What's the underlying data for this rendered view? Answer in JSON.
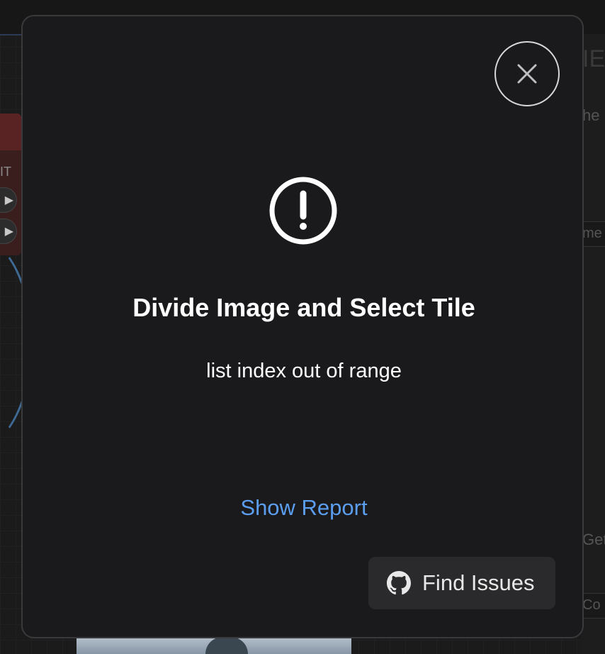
{
  "background": {
    "left_node_label": "IT",
    "left_node_play": "▶",
    "right_fragments": [
      "IE",
      "he",
      "me",
      "Get",
      "Co"
    ]
  },
  "modal": {
    "title": "Divide Image and Select Tile",
    "message": "list index out of range",
    "show_report_label": "Show Report",
    "find_issues_label": "Find Issues",
    "close_icon": "close-icon",
    "alert_icon": "exclamation-circle-icon",
    "github_icon": "github-icon"
  },
  "colors": {
    "modal_bg": "#1a1a1c",
    "link": "#5b9ef0",
    "button_bg": "#2a2a2c"
  }
}
